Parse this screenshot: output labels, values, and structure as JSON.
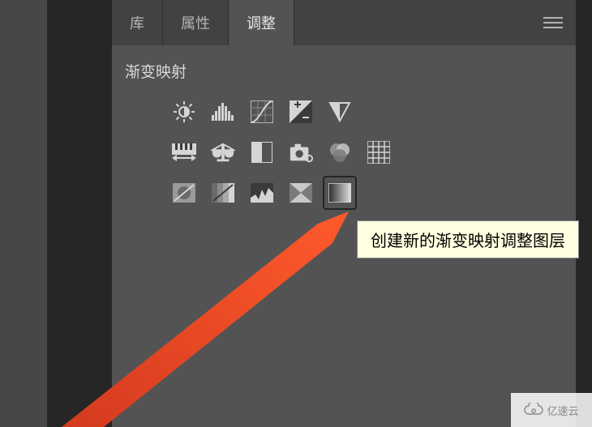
{
  "tabs": {
    "library": "库",
    "properties": "属性",
    "adjustments": "调整"
  },
  "panel": {
    "title": "渐变映射"
  },
  "tooltip": {
    "text": "创建新的渐变映射调整图层"
  },
  "watermark": {
    "text": "亿速云"
  }
}
